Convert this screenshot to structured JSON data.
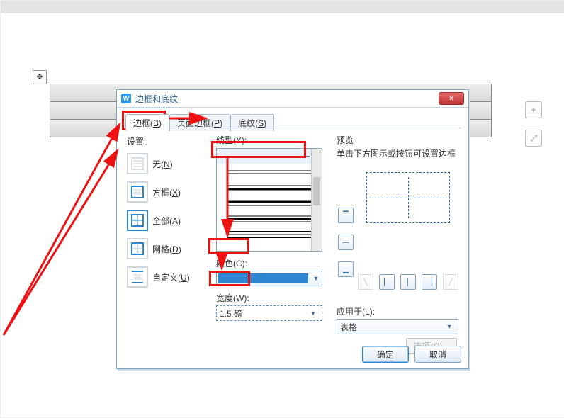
{
  "dialog": {
    "title": "边框和底纹",
    "close_icon": "×",
    "tabs": [
      {
        "label": "边框",
        "hotkey": "B"
      },
      {
        "label": "页面边框",
        "hotkey": "P"
      },
      {
        "label": "底纹",
        "hotkey": "S"
      }
    ],
    "settings_label": "设置:",
    "settings": [
      {
        "label": "无",
        "hotkey": "N"
      },
      {
        "label": "方框",
        "hotkey": "X"
      },
      {
        "label": "全部",
        "hotkey": "A"
      },
      {
        "label": "网格",
        "hotkey": "D"
      },
      {
        "label": "自定义",
        "hotkey": "U"
      }
    ],
    "style_label": "线型(Y):",
    "color_label": "颜色(C):",
    "width_label": "宽度(W):",
    "width_value": "1.5 磅",
    "preview_label": "预览",
    "preview_hint": "单击下方图示或按钮可设置边框",
    "apply_label": "应用于(L):",
    "apply_value": "表格",
    "options_btn": "选项(O)...",
    "ok": "确定",
    "cancel": "取消"
  }
}
